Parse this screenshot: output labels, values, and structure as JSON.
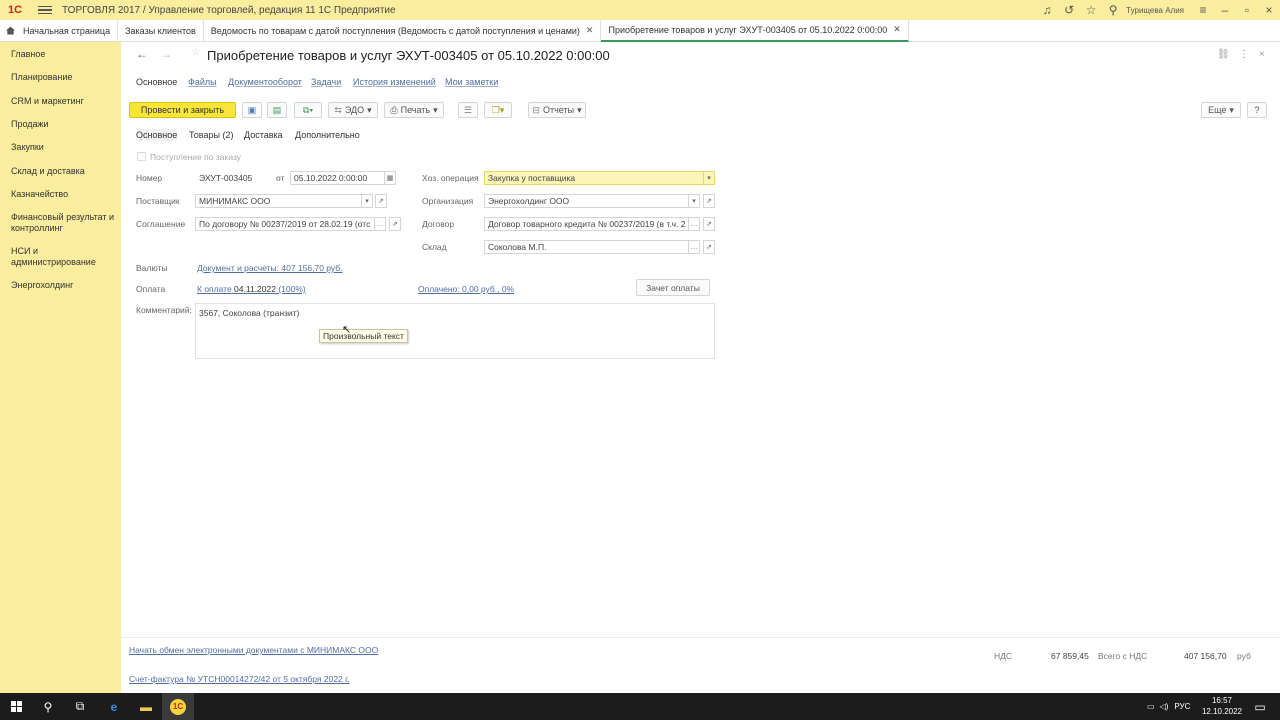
{
  "app": {
    "logo": "1С",
    "title": "ТОРГОВЛЯ 2017 / Управление торговлей, редакция 11 1С Предприятие",
    "user": "Турищева Алия"
  },
  "tabs": [
    {
      "label": "Начальная страница"
    },
    {
      "label": "Заказы клиентов"
    },
    {
      "label": "Ведомость по товарам с датой поступления (Ведомость с датой поступления и ценами)"
    },
    {
      "label": "Приобретение товаров и услуг ЭХУТ-003405 от 05.10.2022 0:00:00"
    }
  ],
  "sidebar": {
    "items": [
      {
        "label": "Главное"
      },
      {
        "label": "Планирование"
      },
      {
        "label": "CRM и маркетинг"
      },
      {
        "label": "Продажи"
      },
      {
        "label": "Закупки"
      },
      {
        "label": "Склад и доставка"
      },
      {
        "label": "Казначейство"
      },
      {
        "label": "Финансовый результат и контроллинг"
      },
      {
        "label": "НСИ и администрирование"
      },
      {
        "label": "Энергохолдинг"
      }
    ]
  },
  "document": {
    "title": "Приобретение товаров и услуг ЭХУТ-003405 от 05.10.2022 0:00:00",
    "menu": {
      "main": "Основное",
      "files": "Файлы",
      "docflow": "Документооборот",
      "tasks": "Задачи",
      "history": "История изменений",
      "notes": "Мои заметки"
    },
    "toolbar": {
      "post_close": "Провести и закрыть",
      "edo": "ЭДО",
      "print": "Печать",
      "reports": "Отчеты",
      "more": "Еще",
      "help": "?"
    },
    "subtabs": [
      {
        "label": "Основное"
      },
      {
        "label": "Товары (2)"
      },
      {
        "label": "Доставка"
      },
      {
        "label": "Дополнительно"
      }
    ],
    "form": {
      "by_order_label": "Поступление по заказу",
      "number_label": "Номер",
      "number": "ЭХУТ-003405",
      "from_label": "от",
      "date": "05.10.2022  0:00:00",
      "supplier_label": "Поставщик",
      "supplier": "МИНИМАКС ООО",
      "agreement_label": "Соглашение",
      "agreement": "По договору № 00237/2019 от 28.02.19 (отс",
      "operation_label": "Хоз. операция",
      "operation": "Закупка у поставщика",
      "organization_label": "Организация",
      "organization": "Энергохолдинг ООО",
      "contract_label": "Договор",
      "contract": "Договор товарного кредита № 00237/2019 (в т.ч. 2",
      "warehouse_label": "Склад",
      "warehouse": "Соколова М.П.",
      "currency_label": "Валюты",
      "currency_link": "Документ и расчеты: 407 156,70 руб.",
      "payment_label": "Оплата",
      "to_pay_prefix": "К оплате",
      "to_pay_date": "04.11.2022",
      "to_pay_suffix": "(100%)",
      "paid": "Оплачено: 0,00 руб., 0%",
      "offset_button": "Зачет оплаты",
      "comment_label": "Комментарий:",
      "comment": "3567, Соколова (транзит)",
      "tooltip": "Произвольный текст"
    },
    "footer": {
      "edo_link": "Начать обмен электронными документами с МИНИМАКС ООО",
      "invoice_link": "Счет-фактура № УТСН00014272/42 от 5 октября 2022 г.",
      "vat_label": "НДС",
      "vat_value": "67 859,45",
      "total_label": "Всего с НДС",
      "total_value": "407 156,70",
      "currency": "руб"
    }
  },
  "taskbar": {
    "lang": "РУС",
    "time": "16:57",
    "date": "12.10.2022"
  }
}
